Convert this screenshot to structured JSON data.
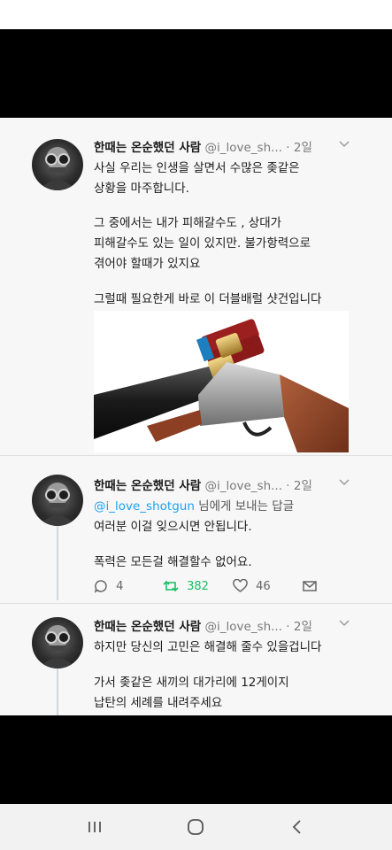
{
  "tweet1": {
    "name": "한때는 온순했던 사람",
    "handle": "@i_love_sh... · 2일",
    "lines": [
      "사실 우리는 인생을 살면서 수많은 좆같은",
      "상황을 마주합니다.",
      "그 중에서는 내가 피해갈수도 , 상대가",
      "피해갈수도 있는 일이 있지만. 불가항력으로",
      "겪어야 할때가 있지요",
      "그럴때 필요한게 바로 이 더블배럴 샷건입니다"
    ],
    "image": "double-barrel-shotgun-photo"
  },
  "tweet2": {
    "name": "한때는 온순했던 사람",
    "handle": "@i_love_sh... · 2일",
    "reply_user": "@i_love_shotgun",
    "reply_suffix": " 님에게 보내는 답글",
    "lines": [
      "여러분 이걸 잊으시면 안됩니다.",
      "폭력은 모든걸 해결할수 없어요."
    ],
    "replies": "4",
    "retweets": "382",
    "likes": "46"
  },
  "tweet3": {
    "name": "한때는 온순했던 사람",
    "handle": "@i_love_sh... · 2일",
    "lines": [
      "하지만 당신의 고민은 해결해 줄수 있을겁니다",
      "가서 좆같은 새끼의 대가리에 12게이지",
      "납탄의 세례를 내려주세요"
    ]
  },
  "colors": {
    "accent": "#1da1f2",
    "retweet": "#17bf63",
    "muted": "#7a7a7a"
  },
  "navbar": {
    "icons": [
      "recent-apps-icon",
      "home-icon",
      "back-icon"
    ]
  }
}
